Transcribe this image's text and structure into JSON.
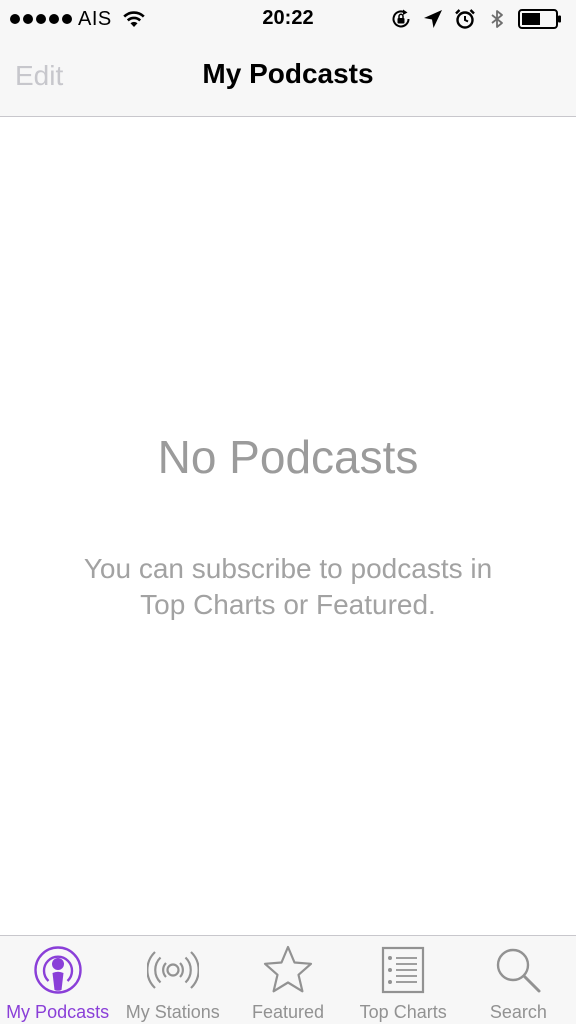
{
  "status_bar": {
    "carrier": "AIS",
    "time": "20:22",
    "signal_bars": 5
  },
  "nav": {
    "edit_label": "Edit",
    "title": "My Podcasts"
  },
  "empty_state": {
    "title": "No Podcasts",
    "line1": "You can subscribe to podcasts in",
    "line2": "Top Charts or Featured."
  },
  "tabs": [
    {
      "label": "My Podcasts",
      "icon": "podcast-icon",
      "active": true
    },
    {
      "label": "My Stations",
      "icon": "stations-icon",
      "active": false
    },
    {
      "label": "Featured",
      "icon": "star-icon",
      "active": false
    },
    {
      "label": "Top Charts",
      "icon": "list-icon",
      "active": false
    },
    {
      "label": "Search",
      "icon": "search-icon",
      "active": false
    }
  ],
  "colors": {
    "accent": "#8a3fd8",
    "inactive": "#929292",
    "empty_text": "#9b9b9b"
  }
}
